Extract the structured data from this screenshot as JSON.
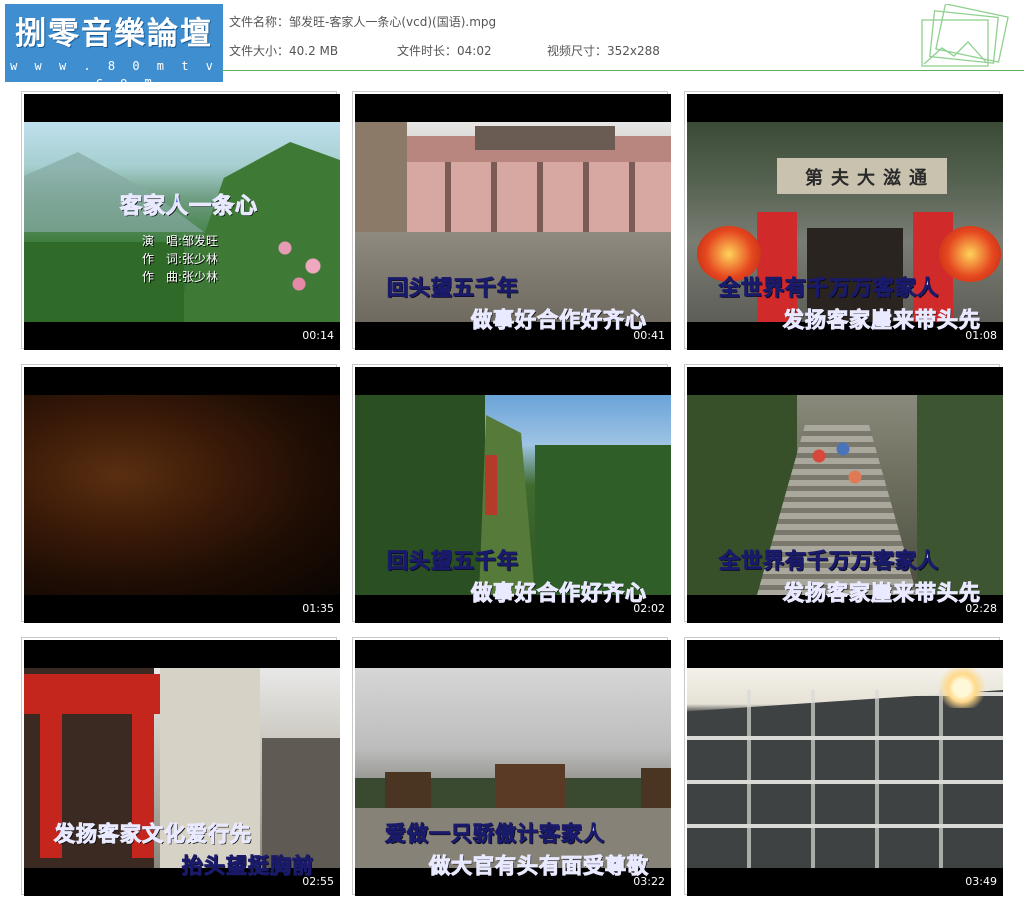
{
  "logo": {
    "text": "捌零音樂論壇",
    "url": "w w w . 8 0 m t v . c o m"
  },
  "file": {
    "name_label": "文件名称：",
    "name": "邹发旺-客家人一条心(vcd)(国语).mpg",
    "size_label": "文件大小：",
    "size": "40.2 MB",
    "duration_label": "文件时长：",
    "duration": "04:02",
    "dims_label": "视频尺寸：",
    "dims": "352x288"
  },
  "thumbs": [
    {
      "time": "00:14",
      "title": "客家人一条心",
      "credits": [
        "演　唱:邹发旺",
        "作　词:张少林",
        "作　曲:张少林"
      ]
    },
    {
      "time": "00:41",
      "line1": "回头望五千年",
      "line2": "做事好合作好齐心"
    },
    {
      "time": "01:08",
      "sign": "第夫大滋通",
      "line1": "全世界有千万万客家人",
      "line2": "发扬客家崖来带头先"
    },
    {
      "time": "01:35"
    },
    {
      "time": "02:02",
      "line1": "回头望五千年",
      "line2": "做事好合作好齐心"
    },
    {
      "time": "02:28",
      "line1": "全世界有千万万客家人",
      "line2": "发扬客家崖来带头先"
    },
    {
      "time": "02:55",
      "line1": "发扬客家文化爱行先",
      "line2": "抬头望挺胸前"
    },
    {
      "time": "03:22",
      "line1": "爱做一只骄傲计客家人",
      "line2": "做大官有头有面受尊敬"
    },
    {
      "time": "03:49"
    }
  ]
}
